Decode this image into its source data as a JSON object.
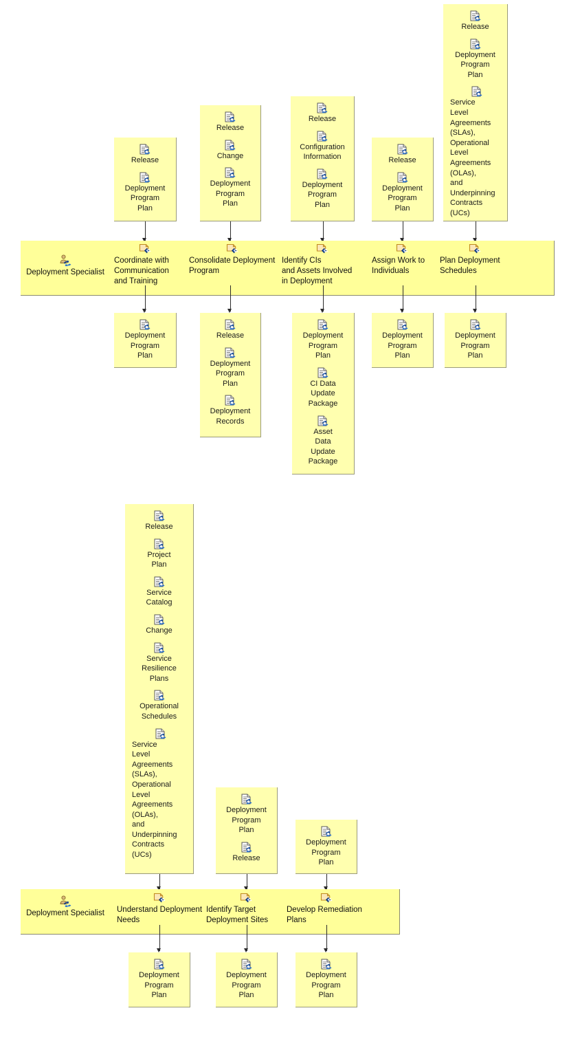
{
  "diagram": {
    "title": "Deployment Specialist activity diagram",
    "colors": {
      "lane_fill": "#ffff99",
      "box_fill": "#ffffaf",
      "border": "#9a9a7a",
      "connector": "#2b2b2b",
      "text": "#1a1a1a"
    },
    "icons": {
      "artifact": "artifact-document-icon",
      "task": "task-activity-icon",
      "role": "role-person-icon"
    }
  },
  "lanes": [
    {
      "id": "lane-top",
      "role": {
        "label": "Deployment Specialist",
        "icon": "role-person-icon"
      },
      "tasks": [
        {
          "id": "t1",
          "label": "Coordinate with\nCommunication\nand Training"
        },
        {
          "id": "t2",
          "label": "Consolidate Deployment\nProgram"
        },
        {
          "id": "t3",
          "label": "Identify CIs\nand Assets Involved\nin Deployment"
        },
        {
          "id": "t4",
          "label": "Assign Work to\nIndividuals"
        },
        {
          "id": "t5",
          "label": "Plan Deployment\nSchedules"
        }
      ],
      "inputs": [
        {
          "for": "t1",
          "items": [
            "Release",
            "Deployment\nProgram\nPlan"
          ]
        },
        {
          "for": "t2",
          "items": [
            "Release",
            "Change",
            "Deployment\nProgram\nPlan"
          ]
        },
        {
          "for": "t3",
          "items": [
            "Release",
            "Configuration\nInformation",
            "Deployment\nProgram\nPlan"
          ]
        },
        {
          "for": "t4",
          "items": [
            "Release",
            "Deployment\nProgram\nPlan"
          ]
        },
        {
          "for": "t5",
          "items": [
            "Release",
            "Deployment\nProgram\nPlan",
            "Service\nLevel\nAgreements\n(SLAs),\nOperational\nLevel\nAgreements\n(OLAs),\nand\nUnderpinning\nContracts\n(UCs)"
          ]
        }
      ],
      "outputs": [
        {
          "for": "t1",
          "items": [
            "Deployment\nProgram\nPlan"
          ]
        },
        {
          "for": "t2",
          "items": [
            "Release",
            "Deployment\nProgram\nPlan",
            "Deployment\nRecords"
          ]
        },
        {
          "for": "t3",
          "items": [
            "Deployment\nProgram\nPlan",
            "CI Data\nUpdate\nPackage",
            "Asset\nData\nUpdate\nPackage"
          ]
        },
        {
          "for": "t4",
          "items": [
            "Deployment\nProgram\nPlan"
          ]
        },
        {
          "for": "t5",
          "items": [
            "Deployment\nProgram\nPlan"
          ]
        }
      ]
    },
    {
      "id": "lane-bottom",
      "role": {
        "label": "Deployment Specialist",
        "icon": "role-person-icon"
      },
      "tasks": [
        {
          "id": "b1",
          "label": "Understand Deployment\nNeeds"
        },
        {
          "id": "b2",
          "label": "Identify Target\nDeployment Sites"
        },
        {
          "id": "b3",
          "label": "Develop Remediation\nPlans"
        }
      ],
      "inputs": [
        {
          "for": "b1",
          "items": [
            "Release",
            "Project\nPlan",
            "Service\nCatalog",
            "Change",
            "Service\nResilience\nPlans",
            "Operational\nSchedules",
            "Service\nLevel\nAgreements\n(SLAs),\nOperational\nLevel\nAgreements\n(OLAs),\nand\nUnderpinning\nContracts\n(UCs)"
          ]
        },
        {
          "for": "b2",
          "items": [
            "Deployment\nProgram\nPlan",
            "Release"
          ]
        },
        {
          "for": "b3",
          "items": [
            "Deployment\nProgram\nPlan"
          ]
        }
      ],
      "outputs": [
        {
          "for": "b1",
          "items": [
            "Deployment\nProgram\nPlan"
          ]
        },
        {
          "for": "b2",
          "items": [
            "Deployment\nProgram\nPlan"
          ]
        },
        {
          "for": "b3",
          "items": [
            "Deployment\nProgram\nPlan"
          ]
        }
      ]
    }
  ]
}
